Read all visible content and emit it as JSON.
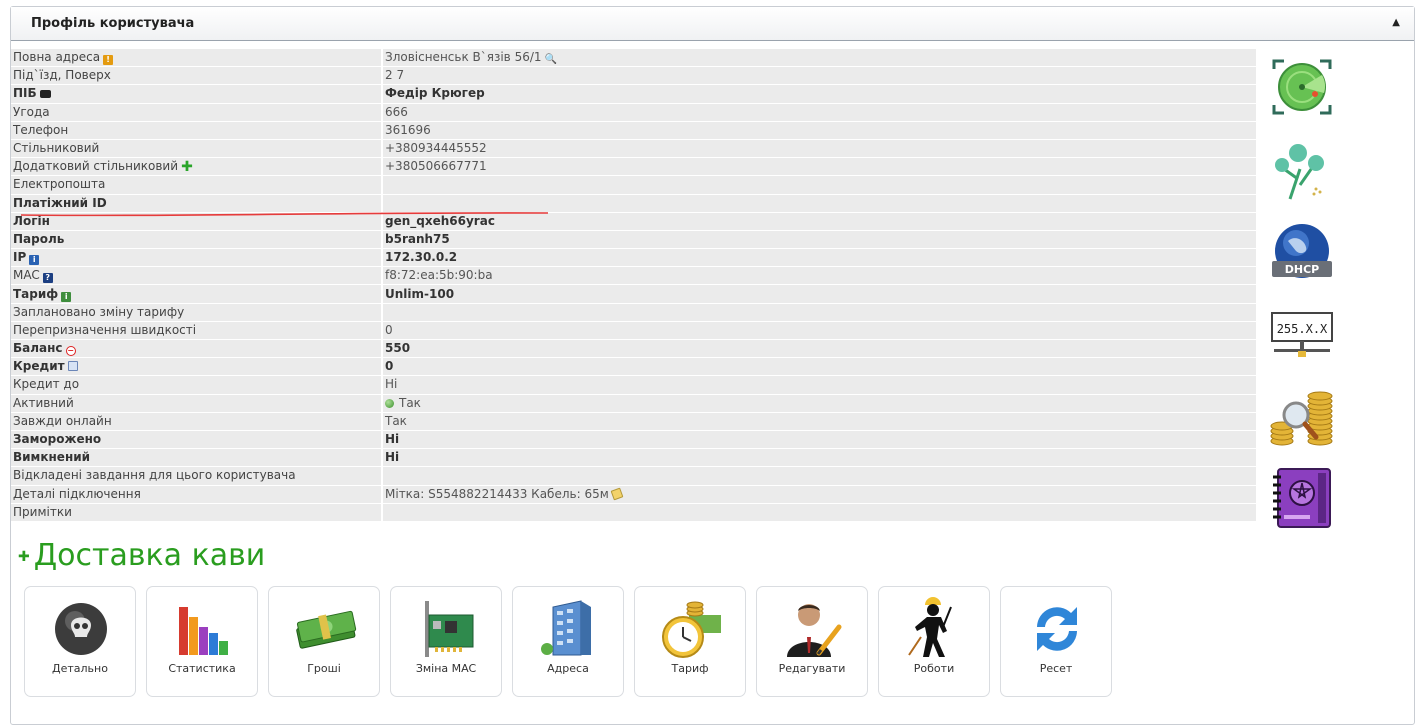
{
  "panel": {
    "title": "Профіль користувача",
    "collapse_glyph": "▲"
  },
  "rows": [
    {
      "label": "Повна адреса",
      "value": "Зловісненськ В`язів 56/1",
      "bold": false,
      "label_icon": "warning-icon",
      "value_icon": "search-icon"
    },
    {
      "label": "Під`їзд, Поверх",
      "value": "2 7",
      "bold": false
    },
    {
      "label": "ПІБ",
      "value": "Федір Крюгер",
      "bold": true,
      "label_icon": "camera-icon"
    },
    {
      "label": "Угода",
      "value": "666",
      "bold": false
    },
    {
      "label": "Телефон",
      "value": "361696",
      "bold": false
    },
    {
      "label": "Стільниковий",
      "value": "+380934445552",
      "bold": false
    },
    {
      "label": "Додатковий стільниковий",
      "value": "+380506667771",
      "bold": false,
      "label_icon": "plus-icon"
    },
    {
      "label": "Електропошта",
      "value": "",
      "bold": false
    },
    {
      "label": "Платіжний ID",
      "value": "",
      "bold": true
    },
    {
      "label": "Логін",
      "value": "gen_qxeh66yrac",
      "bold": true
    },
    {
      "label": "Пароль",
      "value": "b5ranh75",
      "bold": true
    },
    {
      "label": "IP",
      "value": "172.30.0.2",
      "bold": true,
      "label_icon": "info-icon"
    },
    {
      "label": "MAC",
      "value": "f8:72:ea:5b:90:ba",
      "bold": false,
      "label_icon": "help-icon"
    },
    {
      "label": "Тариф",
      "value": "Unlim-100",
      "bold": true,
      "label_icon": "tariff-info-icon"
    },
    {
      "label": "Заплановано зміну тарифу",
      "value": "",
      "bold": false
    },
    {
      "label": "Перепризначення швидкості",
      "value": "0",
      "bold": false
    },
    {
      "label": "Баланс",
      "value": "550",
      "bold": true,
      "label_icon": "minus-circle-icon"
    },
    {
      "label": "Кредит",
      "value": "0",
      "bold": true,
      "label_icon": "calendar-icon"
    },
    {
      "label": "Кредит до",
      "value": "Ні",
      "bold": false
    },
    {
      "label": "Активний",
      "value": "Так",
      "bold": false,
      "value_icon": "active-dot-icon"
    },
    {
      "label": "Завжди онлайн",
      "value": "Так",
      "bold": false
    },
    {
      "label": "Заморожено",
      "value": "Ні",
      "bold": true
    },
    {
      "label": "Вимкнений",
      "value": "Ні",
      "bold": true
    },
    {
      "label": "Відкладені завдання для цього користувача",
      "value": "",
      "bold": false
    },
    {
      "label": "Деталі підключення",
      "value": "Мітка: S554882214433 Кабель: 65м",
      "bold": false,
      "value_icon": "tag-icon"
    },
    {
      "label": "Примітки",
      "value": "",
      "bold": false
    }
  ],
  "side_icons": [
    "radar-icon",
    "plants-icon",
    "dhcp-globe-icon",
    "netmask-icon",
    "coins-search-icon",
    "purple-book-icon"
  ],
  "side_icon_texts": {
    "dhcp": "DHCP",
    "netmask": "255.X.X"
  },
  "section": {
    "title": "Доставка кави"
  },
  "tiles": [
    {
      "label": "Детально",
      "icon": "skull-ball-icon"
    },
    {
      "label": "Статистика",
      "icon": "bar-chart-icon"
    },
    {
      "label": "Гроші",
      "icon": "money-icon"
    },
    {
      "label": "Зміна MAC",
      "icon": "network-card-icon"
    },
    {
      "label": "Адреса",
      "icon": "building-icon"
    },
    {
      "label": "Тариф",
      "icon": "clock-coins-icon"
    },
    {
      "label": "Редагувати",
      "icon": "user-edit-icon"
    },
    {
      "label": "Роботи",
      "icon": "worker-icon"
    },
    {
      "label": "Ресет",
      "icon": "refresh-icon"
    }
  ]
}
